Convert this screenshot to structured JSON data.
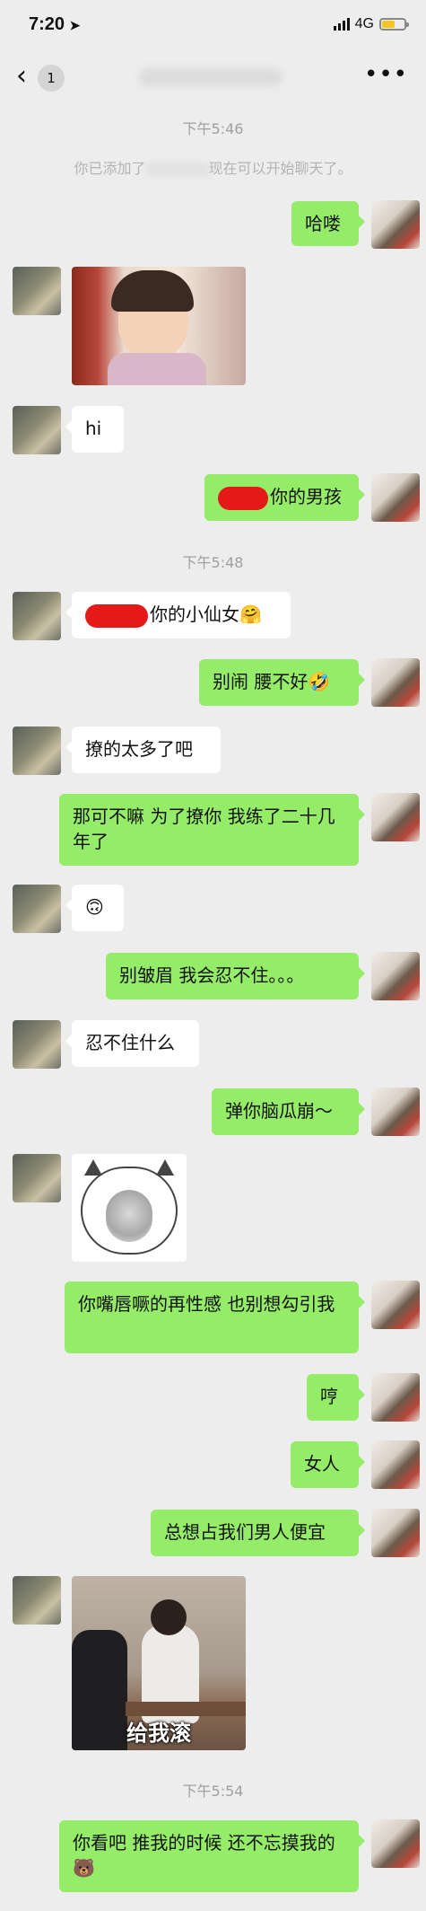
{
  "status_bar": {
    "time": "7:20",
    "network": "4G"
  },
  "nav": {
    "back_count": "1",
    "more": "•••"
  },
  "timestamps": {
    "t1": "下午5:46",
    "t2": "下午5:48",
    "t3": "下午5:54"
  },
  "system": {
    "added_prefix": "你已添加了",
    "added_suffix": "现在可以开始聊天了。"
  },
  "messages": {
    "m1": "哈喽",
    "m3": "hi",
    "m4": "你的男孩",
    "m5": "你的小仙女🤗",
    "m6": "别闹 腰不好🤣",
    "m7": "撩的太多了吧",
    "m8": "那可不嘛 为了撩你 我练了二十几年了",
    "m9": "🙃",
    "m10": "别皱眉 我会忍不住。。。",
    "m11": "忍不住什么",
    "m12": "弹你脑瓜崩～",
    "m14": "你嘴唇噘的再性感 也别想勾引我",
    "m15": "哼",
    "m16": "女人",
    "m17": "总想占我们男人便宜",
    "m18_caption": "给我滚",
    "m19": "你看吧 推我的时候 还不忘摸我的🐻"
  },
  "colors": {
    "outgoing": "#95ec69",
    "incoming": "#ffffff",
    "background": "#ededed"
  }
}
